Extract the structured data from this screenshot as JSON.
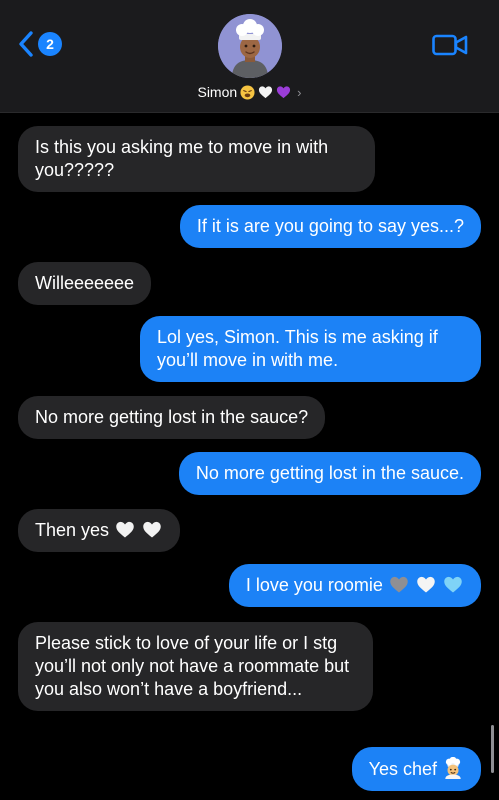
{
  "header": {
    "back_badge": "2",
    "contact_name": "Simon",
    "contact_emojis": [
      "weary-face",
      "white-heart",
      "purple-heart"
    ]
  },
  "messages": [
    {
      "side": "in",
      "text": "Is this you asking me to move in with you?????"
    },
    {
      "side": "out",
      "text": "If it is are you going to say yes...?"
    },
    {
      "side": "in",
      "text": "Willeeeeeee"
    },
    {
      "side": "out",
      "text": "Lol yes, Simon. This is me asking if you’ll move in with me."
    },
    {
      "side": "in",
      "text": "No more getting lost in the sauce?"
    },
    {
      "side": "out",
      "text": "No more getting lost in the sauce."
    },
    {
      "side": "in",
      "text": "Then yes",
      "emojis": [
        "white-heart",
        "white-heart"
      ]
    },
    {
      "side": "out",
      "text": "I love you roomie",
      "emojis": [
        "grey-heart",
        "white-heart",
        "light-blue-heart"
      ]
    },
    {
      "side": "in",
      "text": "Please stick to love of your life or I stg you’ll not only not have a roommate but you also won’t have a boyfriend..."
    },
    {
      "side": "out",
      "text": "Yes chef",
      "emojis": [
        "cook-emoji"
      ]
    }
  ],
  "colors": {
    "incoming_bubble": "#262628",
    "outgoing_bubble": "#1c82f6",
    "accent": "#1a84ff",
    "header_bg": "#1b1b1d"
  }
}
